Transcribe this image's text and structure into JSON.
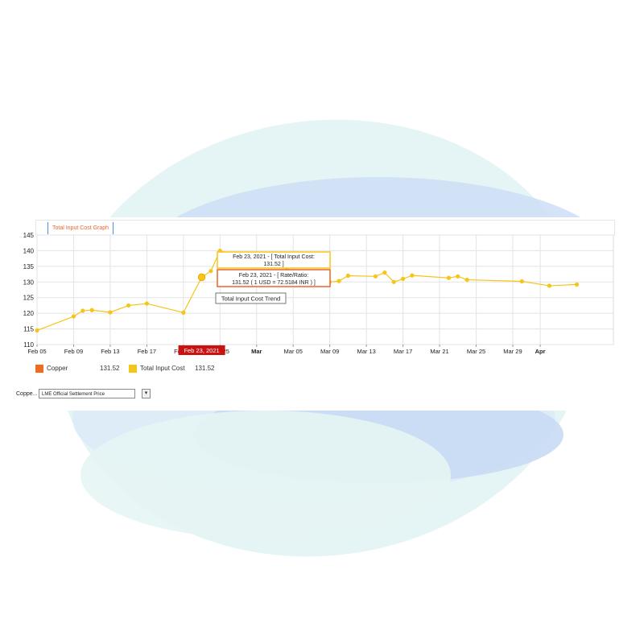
{
  "colors": {
    "accent_orange": "#e8662a",
    "series_yellow": "#f5c518",
    "copper_orange": "#f26b1d",
    "crosshair_red": "#cc1111",
    "tab_border": "#4a90e2"
  },
  "tab": {
    "label": "Total Input Cost Graph"
  },
  "tooltip": {
    "line1": "Feb 23, 2021 - [ Total Input Cost:",
    "line2": "131.52 ]",
    "line3": "Feb 23, 2021 - [ Rate/Ratio:",
    "line4": "131.52 ( 1 USD = 72.5184 INR ) ]",
    "series_title": "Total Input Cost Trend",
    "crosshair_label": "Feb 23, 2021"
  },
  "legend": [
    {
      "name": "Copper",
      "value": "131.52",
      "color": "#f26b1d"
    },
    {
      "name": "Total Input Cost",
      "value": "131.52",
      "color": "#f5c518"
    }
  ],
  "selector": {
    "label": "Coppe...",
    "selected": "LME Official Settlement Price"
  },
  "chart_data": {
    "type": "line",
    "x_ticks": [
      "Feb 05",
      "Feb 09",
      "Feb 13",
      "Feb 17",
      "Feb 21",
      "Feb 25",
      "Mar",
      "Mar 05",
      "Mar 09",
      "Mar 13",
      "Mar 17",
      "Mar 21",
      "Mar 25",
      "Mar 29",
      "Apr"
    ],
    "x_ticks_bold": [
      "Mar",
      "Apr"
    ],
    "y_ticks": [
      110,
      115,
      120,
      125,
      130,
      135,
      140,
      145
    ],
    "ylim": [
      110,
      145
    ],
    "grid": true,
    "highlighted_point": {
      "x": "2021-02-23",
      "y": 131.52
    },
    "series": [
      {
        "name": "Total Input Cost",
        "points": [
          {
            "x": "2021-02-05",
            "y": 114.5
          },
          {
            "x": "2021-02-09",
            "y": 119.0
          },
          {
            "x": "2021-02-10",
            "y": 120.8
          },
          {
            "x": "2021-02-11",
            "y": 121.0
          },
          {
            "x": "2021-02-13",
            "y": 120.3
          },
          {
            "x": "2021-02-15",
            "y": 122.5
          },
          {
            "x": "2021-02-17",
            "y": 123.1
          },
          {
            "x": "2021-02-21",
            "y": 120.2
          },
          {
            "x": "2021-02-23",
            "y": 131.52
          },
          {
            "x": "2021-02-24",
            "y": 133.5
          },
          {
            "x": "2021-02-25",
            "y": 140.0
          },
          {
            "x": "2021-03-07",
            "y": 132.0
          },
          {
            "x": "2021-03-08",
            "y": 132.2
          },
          {
            "x": "2021-03-09",
            "y": 130.0
          },
          {
            "x": "2021-03-10",
            "y": 130.3
          },
          {
            "x": "2021-03-11",
            "y": 132.0
          },
          {
            "x": "2021-03-14",
            "y": 131.8
          },
          {
            "x": "2021-03-15",
            "y": 133.0
          },
          {
            "x": "2021-03-16",
            "y": 130.0
          },
          {
            "x": "2021-03-17",
            "y": 131.0
          },
          {
            "x": "2021-03-18",
            "y": 132.1
          },
          {
            "x": "2021-03-22",
            "y": 131.3
          },
          {
            "x": "2021-03-23",
            "y": 131.8
          },
          {
            "x": "2021-03-24",
            "y": 130.7
          },
          {
            "x": "2021-03-30",
            "y": 130.2
          },
          {
            "x": "2021-04-02",
            "y": 128.8
          },
          {
            "x": "2021-04-05",
            "y": 129.2
          }
        ]
      }
    ]
  }
}
